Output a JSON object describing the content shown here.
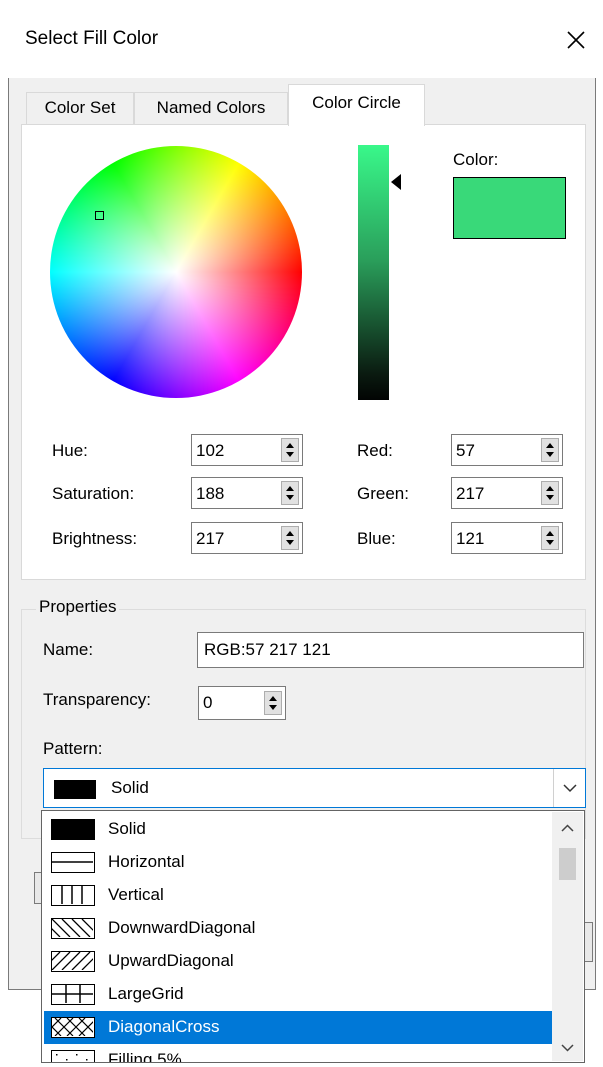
{
  "window": {
    "title": "Select Fill Color",
    "close_icon": "close-icon"
  },
  "tabs": [
    {
      "label": "Color Set",
      "active": false
    },
    {
      "label": "Named Colors",
      "active": false
    },
    {
      "label": "Color Circle",
      "active": true
    }
  ],
  "color_circle": {
    "color_label": "Color:",
    "selected_color": "#39d979",
    "fields": {
      "hue": {
        "label": "Hue:",
        "value": "102"
      },
      "saturation": {
        "label": "Saturation:",
        "value": "188"
      },
      "brightness": {
        "label": "Brightness:",
        "value": "217"
      },
      "red": {
        "label": "Red:",
        "value": "57"
      },
      "green": {
        "label": "Green:",
        "value": "217"
      },
      "blue": {
        "label": "Blue:",
        "value": "121"
      }
    }
  },
  "properties": {
    "group_title": "Properties",
    "name_label": "Name:",
    "name_value": "RGB:57 217 121",
    "transparency_label": "Transparency:",
    "transparency_value": "0",
    "pattern_label": "Pattern:",
    "pattern_selected": "Solid"
  },
  "pattern_dropdown": {
    "items": [
      {
        "label": "Solid",
        "icon": "pattern-solid-icon"
      },
      {
        "label": "Horizontal",
        "icon": "pattern-horizontal-icon"
      },
      {
        "label": "Vertical",
        "icon": "pattern-vertical-icon"
      },
      {
        "label": "DownwardDiagonal",
        "icon": "pattern-downward-diagonal-icon"
      },
      {
        "label": "UpwardDiagonal",
        "icon": "pattern-upward-diagonal-icon"
      },
      {
        "label": "LargeGrid",
        "icon": "pattern-large-grid-icon"
      },
      {
        "label": "DiagonalCross",
        "icon": "pattern-diagonal-cross-icon",
        "highlighted": true
      },
      {
        "label": "Filling 5%",
        "icon": "pattern-filling-5-icon"
      }
    ]
  },
  "colors": {
    "accent": "#0078d7",
    "dialog_bg": "#f0f0f0"
  }
}
